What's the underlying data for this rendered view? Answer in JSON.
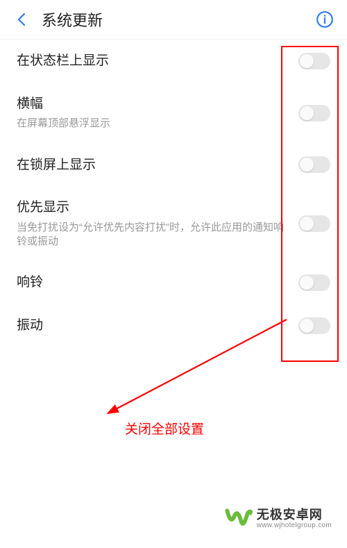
{
  "header": {
    "title": "系统更新"
  },
  "items": [
    {
      "title": "在状态栏上显示",
      "sub": ""
    },
    {
      "title": "横幅",
      "sub": "在屏幕顶部悬浮显示"
    },
    {
      "title": "在锁屏上显示",
      "sub": ""
    },
    {
      "title": "优先显示",
      "sub": "当免打扰设为“允许优先内容打扰”时，允许此应用的通知响铃或振动"
    },
    {
      "title": "响铃",
      "sub": ""
    },
    {
      "title": "振动",
      "sub": ""
    }
  ],
  "annotation": {
    "label": "关闭全部设置"
  },
  "brand": {
    "cn": "无极安卓网",
    "en": "www.wjhotelgroup.com"
  }
}
